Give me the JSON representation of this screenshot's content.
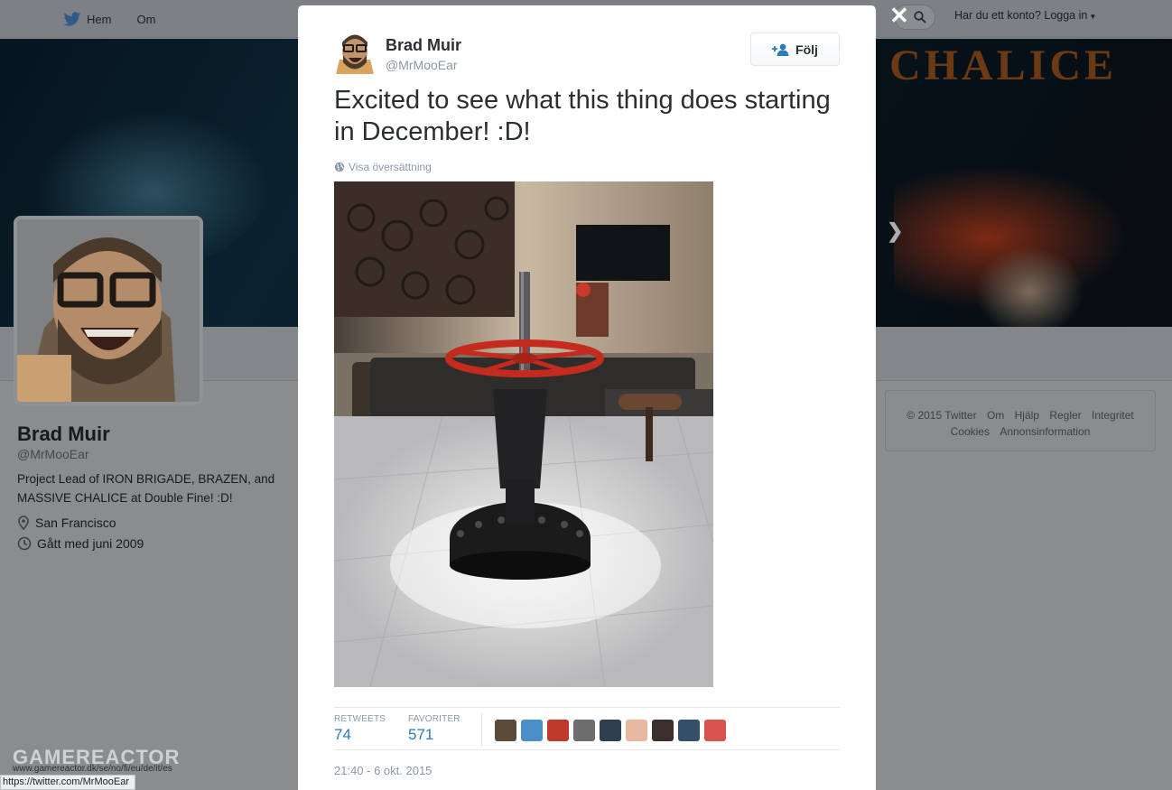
{
  "topbar": {
    "nav": [
      "Hem",
      "Om"
    ],
    "login": "Har du ett konto? Logga in"
  },
  "banner": {
    "text": "CHALICE"
  },
  "profile": {
    "name": "Brad Muir",
    "handle": "@MrMooEar",
    "bio": "Project Lead of IRON BRIGADE, BRAZEN, and MASSIVE CHALICE at Double Fine! :D!",
    "location": "San Francisco",
    "joined": "Gått med juni 2009"
  },
  "footer": {
    "links": [
      "© 2015 Twitter",
      "Om",
      "Hjälp",
      "Regler",
      "Integritet",
      "Cookies",
      "Annonsinformation"
    ]
  },
  "tweet": {
    "author_name": "Brad Muir",
    "author_handle": "@MrMooEar",
    "follow_label": "Följ",
    "text": "Excited to see what this thing does starting in December! :D!",
    "translate_label": "Visa översättning",
    "retweets_label": "RETWEETS",
    "retweets": "74",
    "favorites_label": "FAVORITER",
    "favorites": "571",
    "timestamp": "21:40 - 6 okt. 2015"
  },
  "favoriters": [
    {
      "color": "#5b4a3a"
    },
    {
      "color": "#4b8fc9"
    },
    {
      "color": "#c0392b"
    },
    {
      "color": "#6d6d6d"
    },
    {
      "color": "#2f3e4e"
    },
    {
      "color": "#e6b8a2"
    },
    {
      "color": "#3a2f2a"
    },
    {
      "color": "#334f6a"
    },
    {
      "color": "#d9534f"
    }
  ],
  "watermark": {
    "brand": "GAMEREACTOR",
    "domains": "www.gamereactor.dk/se/no/fi/eu/de/it/es"
  },
  "statusbar": {
    "url": "https://twitter.com/MrMooEar"
  },
  "colors": {
    "link": "#2b7bb9",
    "muted": "#8899a6",
    "text": "#292f33"
  }
}
